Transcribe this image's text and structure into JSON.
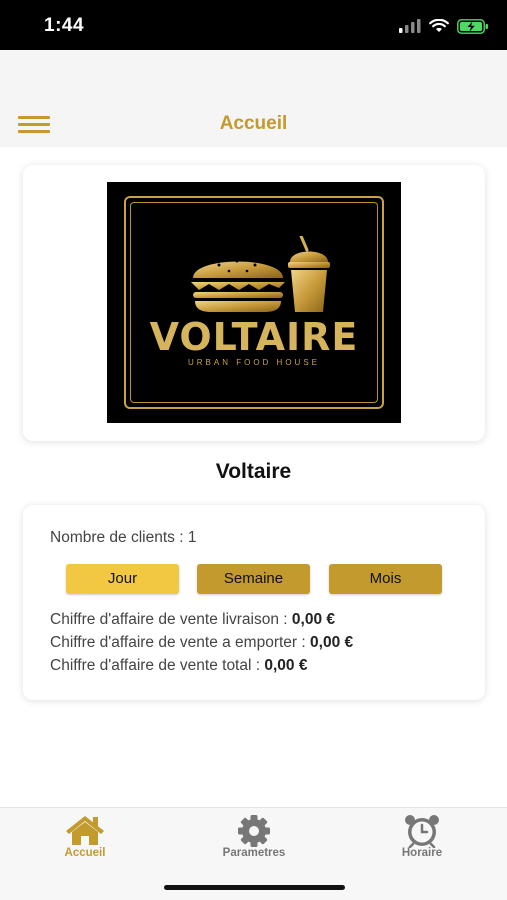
{
  "status_bar": {
    "time": "1:44"
  },
  "header": {
    "title": "Accueil",
    "menu_icon": "hamburger-icon"
  },
  "restaurant": {
    "logo_wordmark": "VOLTAIRE",
    "logo_tagline": "URBAN FOOD HOUSE",
    "name": "Voltaire"
  },
  "stats": {
    "clients_label": "Nombre de clients : ",
    "clients_value": "1",
    "periods": [
      "Jour",
      "Semaine",
      "Mois"
    ],
    "selected_period": "Jour",
    "revenue": [
      {
        "label": "Chiffre d'affaire de vente livraison : ",
        "value": "0,00 €"
      },
      {
        "label": "Chiffre d'affaire de vente a emporter : ",
        "value": "0,00 €"
      },
      {
        "label": "Chiffre d'affaire de vente total : ",
        "value": "0,00 €"
      }
    ]
  },
  "tabs": [
    {
      "label": "Accueil",
      "icon": "home-icon",
      "active": true
    },
    {
      "label": "Parametres",
      "icon": "gear-icon",
      "active": false
    },
    {
      "label": "Horaire",
      "icon": "alarm-clock-icon",
      "active": false
    }
  ],
  "colors": {
    "accent": "#c29a2e",
    "accent_light": "#f2c842",
    "tab_inactive": "#777777"
  }
}
